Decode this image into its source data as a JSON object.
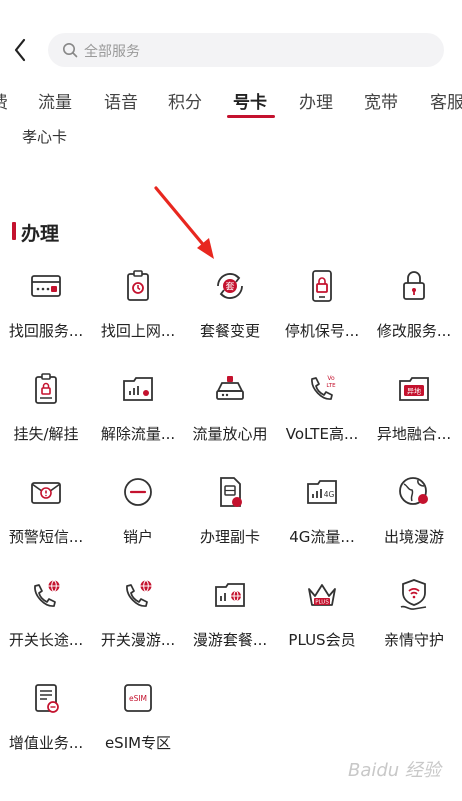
{
  "search": {
    "placeholder": "全部服务"
  },
  "tabs": [
    {
      "label": "费"
    },
    {
      "label": "流量"
    },
    {
      "label": "语音"
    },
    {
      "label": "积分"
    },
    {
      "label": "号卡"
    },
    {
      "label": "办理"
    },
    {
      "label": "宽带"
    },
    {
      "label": "客服"
    }
  ],
  "active_tab": "号卡",
  "subtab": "孝心卡",
  "section": {
    "title": "办理"
  },
  "items": [
    {
      "label": "找回服务...",
      "icon": "password-card-icon"
    },
    {
      "label": "找回上网...",
      "icon": "clipboard-clock-icon"
    },
    {
      "label": "套餐变更",
      "icon": "package-change-icon"
    },
    {
      "label": "停机保号...",
      "icon": "phone-lock-icon"
    },
    {
      "label": "修改服务...",
      "icon": "padlock-icon"
    },
    {
      "label": "挂失/解挂",
      "icon": "clipboard-lock-icon"
    },
    {
      "label": "解除流量...",
      "icon": "data-folder-icon"
    },
    {
      "label": "流量放心用",
      "icon": "router-icon"
    },
    {
      "label": "VoLTE高...",
      "icon": "volte-phone-icon"
    },
    {
      "label": "异地融合...",
      "icon": "remote-folder-icon"
    },
    {
      "label": "预警短信...",
      "icon": "warning-envelope-icon"
    },
    {
      "label": "销户",
      "icon": "minus-circle-icon"
    },
    {
      "label": "办理副卡",
      "icon": "sim-card-icon"
    },
    {
      "label": "4G流量...",
      "icon": "4g-signal-icon"
    },
    {
      "label": "出境漫游",
      "icon": "globe-icon"
    },
    {
      "label": "开关长途...",
      "icon": "phone-globe-icon"
    },
    {
      "label": "开关漫游...",
      "icon": "phone-globe-icon"
    },
    {
      "label": "漫游套餐...",
      "icon": "roaming-folder-icon"
    },
    {
      "label": "PLUS会员",
      "icon": "crown-icon"
    },
    {
      "label": "亲情守护",
      "icon": "shield-hand-icon"
    },
    {
      "label": "增值业务...",
      "icon": "document-icon"
    },
    {
      "label": "eSIM专区",
      "icon": "esim-icon"
    }
  ],
  "badges": {
    "package": "套",
    "volte_top": "Vo",
    "volte_bottom": "LTE",
    "remote": "异地",
    "fourg": "4G",
    "plus": "PLUS",
    "esim": "eSIM"
  },
  "watermark": "Baidu 经验",
  "colors": {
    "accent": "#c4122e",
    "icon_stroke": "#333333",
    "arrow": "#e8271f"
  }
}
